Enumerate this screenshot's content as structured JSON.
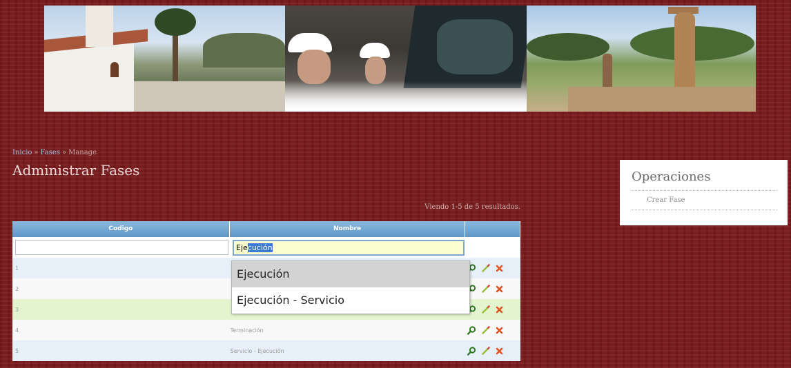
{
  "breadcrumb": {
    "home": "Inicio",
    "separator": "»",
    "section": "Fases",
    "current": "Manage"
  },
  "page": {
    "title": "Administrar Fases",
    "summary": "Viendo 1-5 de 5 resultados."
  },
  "grid": {
    "columns": [
      "Codigo",
      "Nombre",
      ""
    ],
    "filters": {
      "codigo_value": "",
      "nombre_typed": "Eje",
      "nombre_selected_completion": "cución"
    },
    "rows": [
      {
        "codigo": "1",
        "nombre": ""
      },
      {
        "codigo": "2",
        "nombre": ""
      },
      {
        "codigo": "3",
        "nombre": ""
      },
      {
        "codigo": "4",
        "nombre": "Terminación"
      },
      {
        "codigo": "5",
        "nombre": "Servicio - Ejecución"
      }
    ],
    "actions": [
      "view-icon",
      "edit-icon",
      "delete-icon"
    ]
  },
  "autocomplete": {
    "items": [
      "Ejecución",
      "Ejecución - Servicio"
    ]
  },
  "operations": {
    "title": "Operaciones",
    "items": [
      "Crear Fase"
    ]
  },
  "colors": {
    "background": "#7a1a1c",
    "header_blue": "#5d98c8",
    "row_blue": "#e7f0f8",
    "row_green": "#e3f4cf",
    "input_yellow": "#fcffd0"
  }
}
